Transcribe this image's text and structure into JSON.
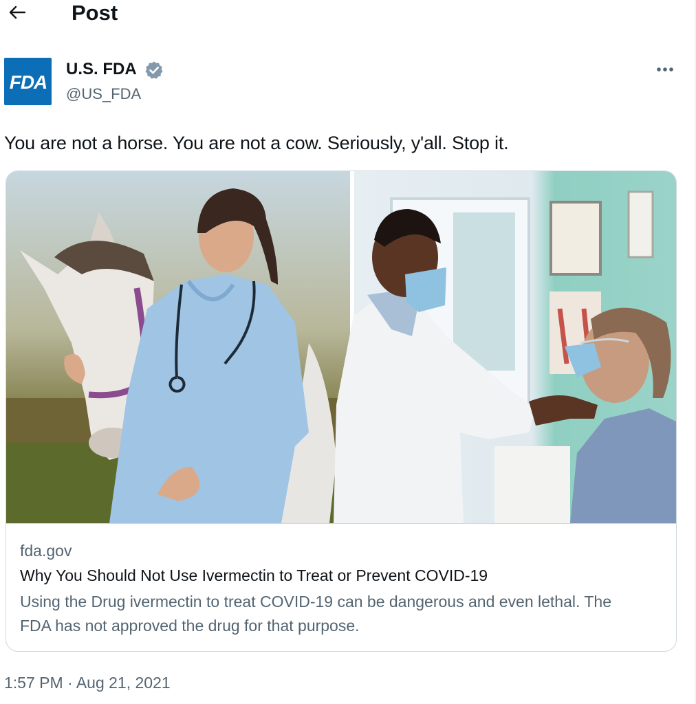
{
  "header": {
    "title": "Post",
    "back_icon": "back-arrow-icon"
  },
  "author": {
    "avatar_text": "FDA",
    "name": "U.S. FDA",
    "handle": "@US_FDA",
    "verified_icon": "verified-badge-icon",
    "avatar_color": "#0d6eb8",
    "verified_color": "#829aab"
  },
  "post": {
    "text": "You are not a horse. You are not a cow. Seriously, y'all. Stop it.",
    "more_icon": "more-options-icon"
  },
  "card": {
    "domain": "fda.gov",
    "title": "Why You Should Not Use Ivermectin to Treat or Prevent COVID-19",
    "description": "Using the Drug ivermectin to treat COVID-19 can be dangerous and even lethal. The FDA has not approved the drug for that purpose."
  },
  "meta": {
    "timestamp": "1:57 PM · Aug 21, 2021"
  },
  "colors": {
    "secondary_text": "#536471",
    "border": "#cfd9de",
    "primary_text": "#0f1419"
  }
}
